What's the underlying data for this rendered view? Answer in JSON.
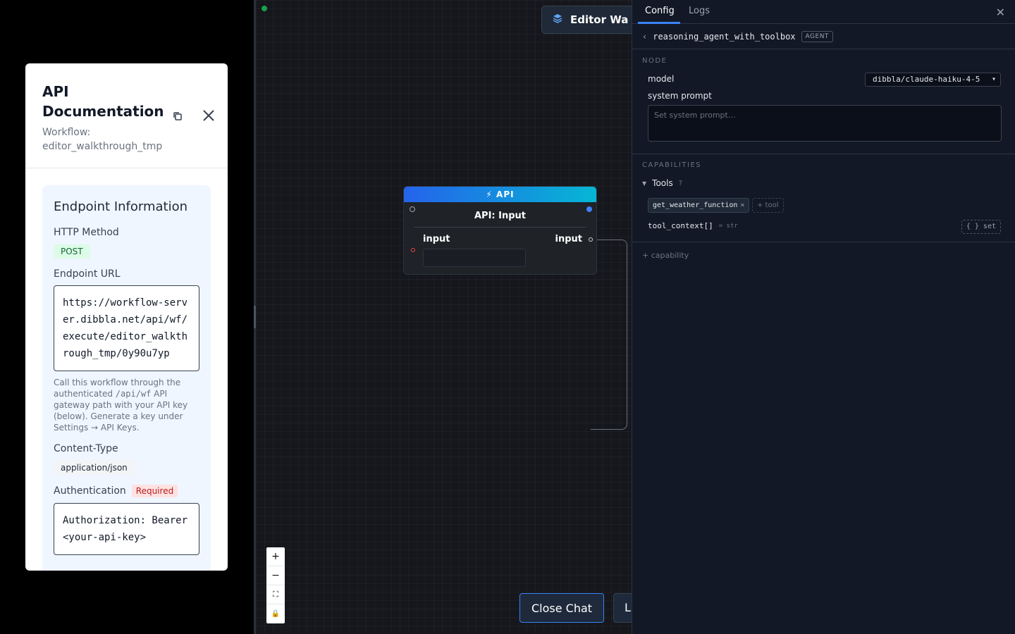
{
  "modal": {
    "title": "API Documentation",
    "subtitle": "Workflow: editor_walkthrough_tmp",
    "card_title": "Endpoint Information",
    "http_method_label": "HTTP Method",
    "http_method": "POST",
    "endpoint_label": "Endpoint URL",
    "endpoint_url": "https://workflow-server.dibbla.net/api/wf/execute/editor_walkthrough_tmp/0y90u7yp",
    "note_pre": "Call this workflow through the authenticated ",
    "note_code": "/api/wf",
    "note_post": " API gateway path with your API key (below). Generate a key under Settings → API Keys.",
    "content_type_label": "Content-Type",
    "content_type": "application/json",
    "auth_label": "Authentication",
    "auth_required": "Required",
    "auth_header": "Authorization: Bearer <your-api-key>"
  },
  "canvas": {
    "walkthrough_button": "Editor Wa",
    "node": {
      "header": "⚡ API",
      "title": "API: Input",
      "input_label": "input",
      "output_label": "input"
    },
    "zoom": [
      "+",
      "−",
      "⛶",
      "🔒"
    ],
    "close_chat": "Close Chat",
    "l_button": "L"
  },
  "panel": {
    "tab_config": "Config",
    "tab_logs": "Logs",
    "close": "✕",
    "back": "‹",
    "node_name": "reasoning_agent_with_toolbox",
    "node_badge": "AGENT",
    "section_node": "NODE",
    "model_label": "model",
    "model_value": "dibbla/claude-haiku-4-5",
    "system_prompt_label": "system prompt",
    "system_prompt_placeholder": "Set system prompt...",
    "section_capabilities": "CAPABILITIES",
    "tools_label": "Tools",
    "tools_help": "?",
    "tool_chip": "get_weather_function",
    "add_tool": "+ tool",
    "ctx_name": "tool_context[]",
    "ctx_type": "= str",
    "ctx_set": "{ } set",
    "add_capability": "+ capability"
  },
  "colors": {
    "accent": "#3b82f6",
    "status_green": "#16a34a",
    "node_gradient_start": "#2563eb",
    "node_gradient_end": "#06b6d4"
  }
}
